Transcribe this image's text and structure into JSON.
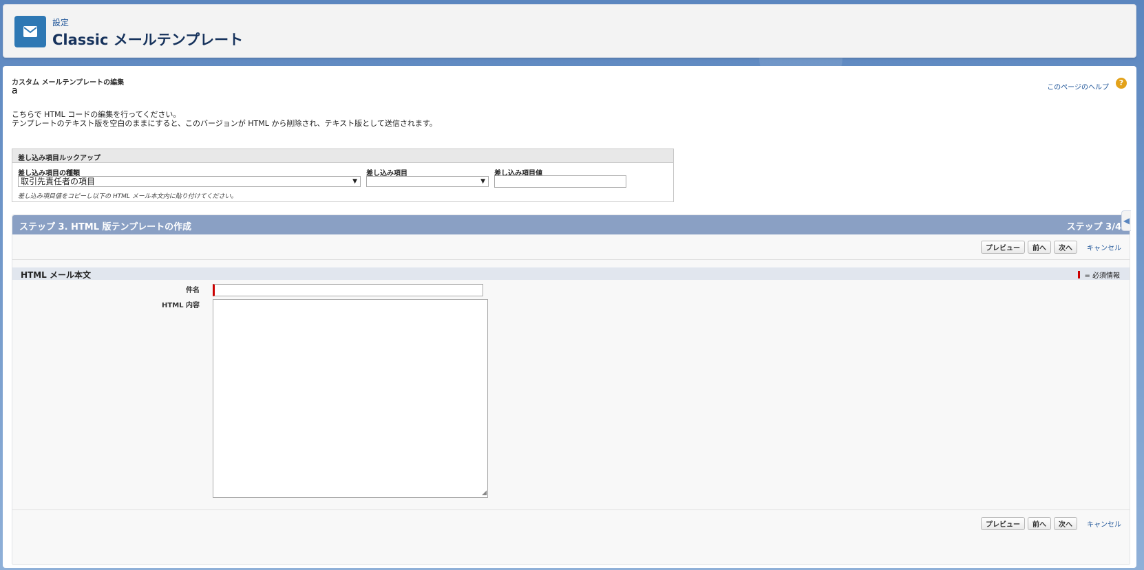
{
  "header": {
    "breadcrumb": "設定",
    "title": "Classic メールテンプレート",
    "icon": "envelope-icon",
    "icon_color": "#2e78b4"
  },
  "page": {
    "edit_label": "カスタム メールテンプレートの編集",
    "template_name": "a",
    "help_link": "このページのヘルプ",
    "help_icon": "?",
    "intro_line1": "こちらで HTML コードの編集を行ってください。",
    "intro_line2": "テンプレートのテキスト版を空白のままにすると、このバージョンが HTML から削除され、テキスト版として送信されます。"
  },
  "merge_lookup": {
    "title": "差し込み項目ルックアップ",
    "type_label": "差し込み項目の種類",
    "type_value": "取引先責任者の項目",
    "field_label": "差し込み項目",
    "field_value": "",
    "value_label": "差し込み項目値",
    "value_value": "",
    "hint": "差し込み項目値をコピーし以下の HTML メール本文内に貼り付けてください。"
  },
  "step": {
    "title": "ステップ 3. HTML 版テンプレートの作成",
    "count": "ステップ 3/4",
    "bar_color": "#8aa0c4"
  },
  "buttons": {
    "preview": "プレビュー",
    "prev": "前へ",
    "next": "次へ",
    "cancel": "キャンセル"
  },
  "section": {
    "title": "HTML メール本文",
    "required_note": "= 必須情報",
    "subject_label": "件名",
    "subject_value": "",
    "content_label": "HTML 内容",
    "content_value": ""
  }
}
